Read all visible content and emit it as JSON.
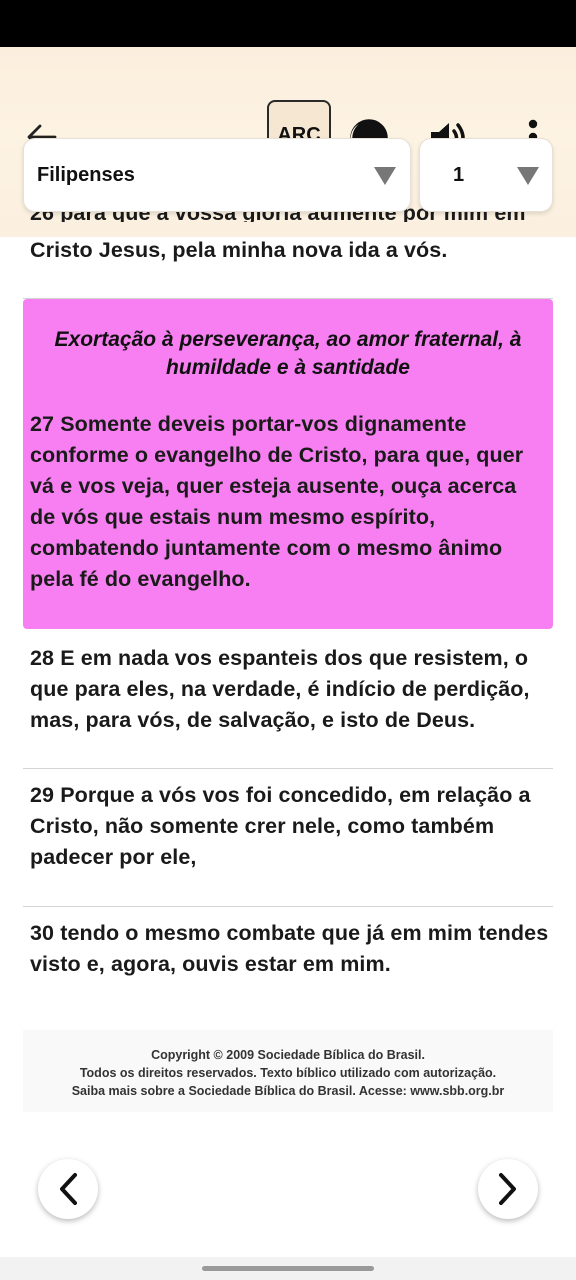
{
  "header": {
    "version_label": "ARC",
    "icons": {
      "back": "arrow-left-icon",
      "theme": "half-moon-contrast-icon",
      "audio": "speaker-volume-icon",
      "menu": "more-vertical-icon"
    }
  },
  "selectors": {
    "book": {
      "value": "Filipenses"
    },
    "chapter": {
      "value": "1"
    }
  },
  "verses": {
    "v26_partial": "26 para que a vossa glória aumente por mim em",
    "v26_rest": "Cristo Jesus, pela minha nova ida a vós.",
    "section_title": "Exortação à perseverança, ao amor fraternal, à humildade e à santidade",
    "v27": "27 Somente deveis portar-vos dignamente conforme o evangelho de Cristo, para que, quer vá e vos veja, quer esteja ausente, ouça acerca de vós que estais num mesmo espírito, combatendo juntamente com o mesmo ânimo pela fé do evangelho.",
    "v28": "28 E em nada vos espanteis dos que resistem, o que para eles, na verdade, é indício de perdição, mas, para vós, de salvação, e isto de Deus.",
    "v29": "29 Porque a vós vos foi concedido, em relação a Cristo, não somente crer nele, como também padecer por ele,",
    "v30": "30 tendo o mesmo combate que já em mim tendes visto e, agora, ouvis estar em mim."
  },
  "colors": {
    "highlight": "#f77ff1",
    "header_bg": "#fdf3e3"
  },
  "copyright": {
    "line1": "Copyright © 2009 Sociedade Bíblica do Brasil.",
    "line2": "Todos os direitos reservados. Texto bíblico utilizado com autorização.",
    "line3": "Saiba mais sobre a Sociedade Bíblica do Brasil. Acesse: www.sbb.org.br"
  },
  "navigation": {
    "prev_icon": "chevron-left-icon",
    "next_icon": "chevron-right-icon"
  }
}
